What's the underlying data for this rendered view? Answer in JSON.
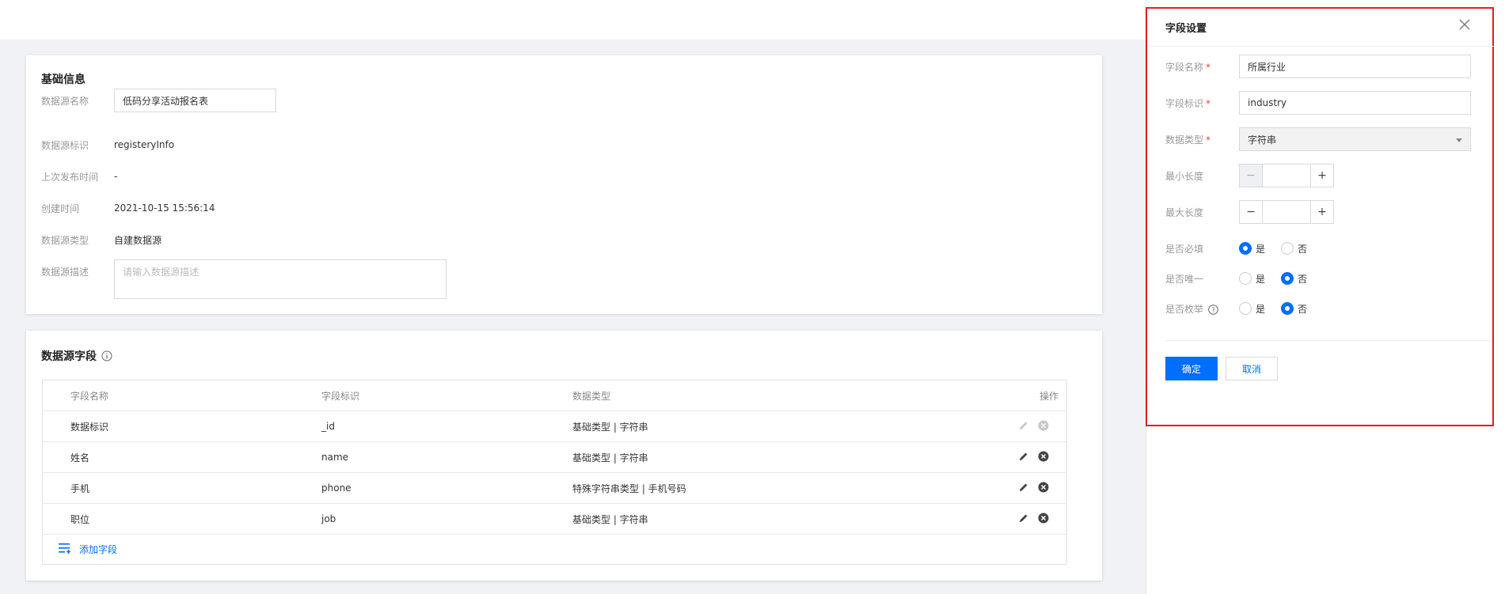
{
  "basic": {
    "title": "基础信息",
    "rows": [
      {
        "label": "数据源名称",
        "value": "低码分享活动报名表"
      },
      {
        "label": "数据源标识",
        "value": "registeryInfo"
      },
      {
        "label": "上次发布时间",
        "value": "-"
      },
      {
        "label": "创建时间",
        "value": "2021-10-15 15:56:14"
      },
      {
        "label": "数据源类型",
        "value": "自建数据源"
      },
      {
        "label": "数据源描述",
        "placeholder": "请输入数据源描述"
      }
    ]
  },
  "fields": {
    "title": "数据源字段",
    "headers": [
      "字段名称",
      "字段标识",
      "数据类型",
      "操作"
    ],
    "rows": [
      {
        "name": "数据标识",
        "key": "_id",
        "type": "基础类型 | 字符串"
      },
      {
        "name": "姓名",
        "key": "name",
        "type": "基础类型 | 字符串"
      },
      {
        "name": "手机",
        "key": "phone",
        "type": "特殊字符串类型 | 手机号码"
      },
      {
        "name": "职位",
        "key": "job",
        "type": "基础类型 | 字符串"
      }
    ],
    "add_label": "添加字段"
  },
  "panel": {
    "title": "字段设置",
    "name_label": "字段名称",
    "name_value": "所属行业",
    "key_label": "字段标识",
    "key_value": "industry",
    "type_label": "数据类型",
    "type_value": "字符串",
    "min_label": "最小长度",
    "max_label": "最大长度",
    "required_label": "是否必填",
    "unique_label": "是否唯一",
    "enum_label": "是否枚举",
    "yes": "是",
    "no": "否",
    "req_mark": "*",
    "confirm": "确定",
    "cancel": "取消"
  },
  "colors": {
    "accent": "#006eff",
    "highlight_frame": "#e02020"
  }
}
